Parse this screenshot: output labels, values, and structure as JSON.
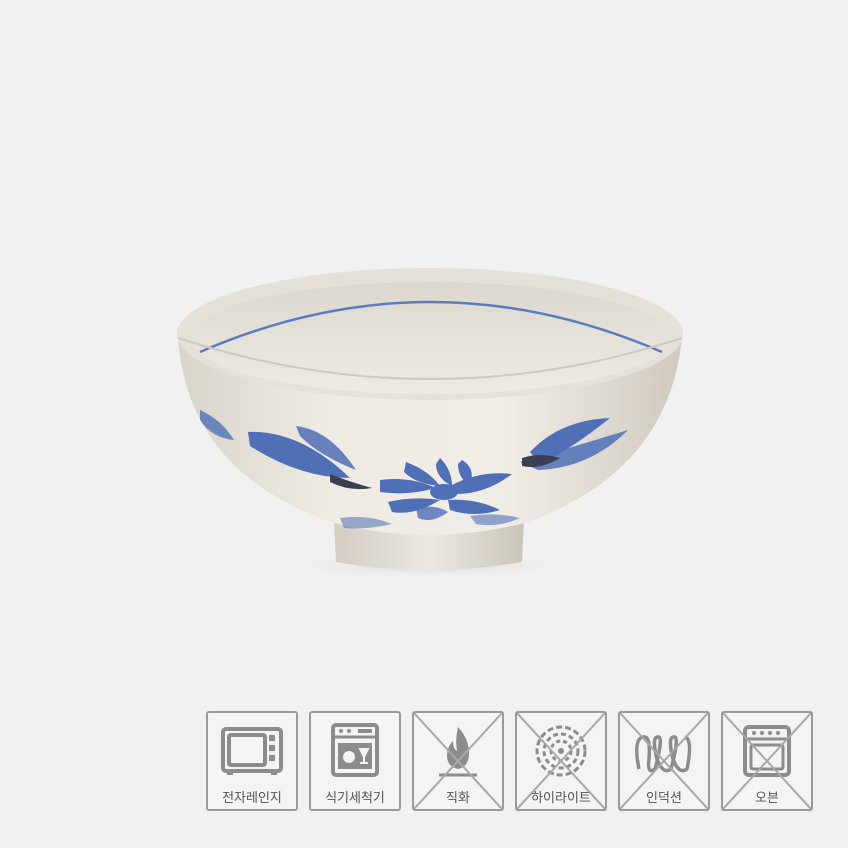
{
  "product": {
    "image_name": "blue-floral-ceramic-rice-bowl"
  },
  "usage_icons": [
    {
      "label": "전자레인지",
      "icon": "microwave-icon",
      "allowed": true
    },
    {
      "label": "식기세척기",
      "icon": "dishwasher-icon",
      "allowed": true
    },
    {
      "label": "직화",
      "icon": "flame-icon",
      "allowed": false
    },
    {
      "label": "하이라이트",
      "icon": "highlight-burner-icon",
      "allowed": false
    },
    {
      "label": "인덕션",
      "icon": "induction-coil-icon",
      "allowed": false
    },
    {
      "label": "오븐",
      "icon": "oven-icon",
      "allowed": false
    }
  ],
  "colors": {
    "background": "#f1f1f1",
    "icon_gray": "#8c8c8c",
    "bowl_cream": "#ece8e0",
    "pattern_blue": "#3f5fa8"
  }
}
